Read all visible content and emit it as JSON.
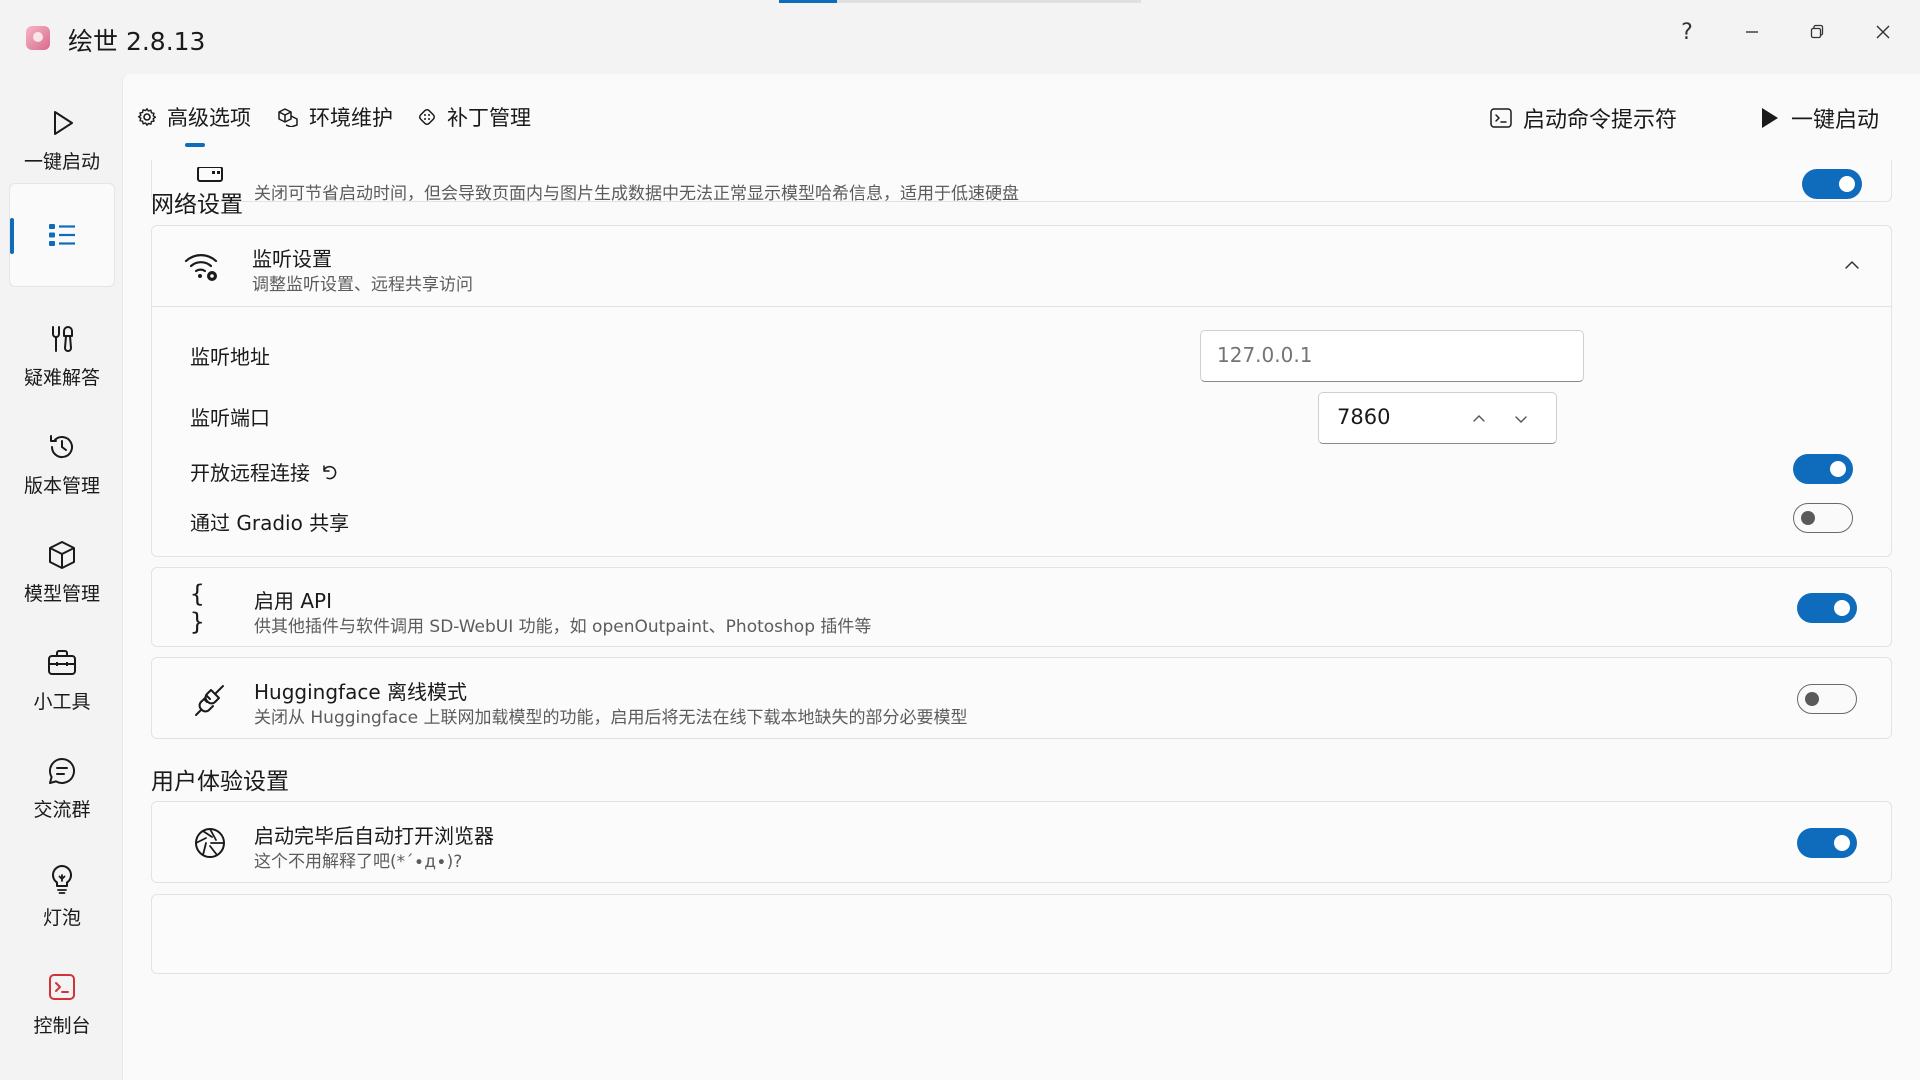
{
  "app": {
    "title": "绘世 2.8.13",
    "progress_fraction": 0.16
  },
  "window_controls": {
    "help": "?"
  },
  "sidebar": {
    "items": [
      {
        "label": "一键启动",
        "icon": "play-icon"
      },
      {
        "label": "",
        "icon": "list-icon",
        "active": true
      },
      {
        "label": "疑难解答",
        "icon": "tools-icon"
      },
      {
        "label": "版本管理",
        "icon": "history-icon"
      },
      {
        "label": "模型管理",
        "icon": "cube-icon"
      },
      {
        "label": "小工具",
        "icon": "toolbox-icon"
      },
      {
        "label": "交流群",
        "icon": "chat-icon"
      },
      {
        "label": "灯泡",
        "icon": "lightbulb-icon"
      },
      {
        "label": "控制台",
        "icon": "console-icon"
      }
    ]
  },
  "toolbar": {
    "tabs": [
      {
        "label": "高级选项",
        "icon": "gear-icon"
      },
      {
        "label": "环境维护",
        "icon": "packages-icon"
      },
      {
        "label": "补丁管理",
        "icon": "patch-icon"
      }
    ],
    "cmd_label": "启动命令提示符",
    "launch_label": "一键启动"
  },
  "top_card": {
    "desc": "关闭可节省启动时间，但会导致页面内与图片生成数据中无法正常显示模型哈希信息，适用于低速硬盘"
  },
  "network": {
    "section_title": "网络设置",
    "listen": {
      "title": "监听设置",
      "desc": "调整监听设置、远程共享访问",
      "address_label": "监听地址",
      "address_placeholder": "127.0.0.1",
      "port_label": "监听端口",
      "port_value": "7860",
      "remote_label": "开放远程连接",
      "remote_on": true,
      "gradio_label": "通过 Gradio 共享",
      "gradio_on": false
    },
    "api": {
      "title": "启用 API",
      "desc": "供其他插件与软件调用 SD-WebUI 功能，如 openOutpaint、Photoshop 插件等",
      "on": true
    },
    "hf": {
      "title": "Huggingface 离线模式",
      "desc": "关闭从 Huggingface 上联网加载模型的功能，启用后将无法在线下载本地缺失的部分必要模型",
      "on": false
    }
  },
  "ux": {
    "section_title": "用户体验设置",
    "browser": {
      "title": "启动完毕后自动打开浏览器",
      "desc": "这个不用解释了吧(*´∙д∙)?",
      "on": true
    }
  },
  "colors": {
    "accent": "#0f6cbd",
    "console_icon": "#d13438"
  }
}
